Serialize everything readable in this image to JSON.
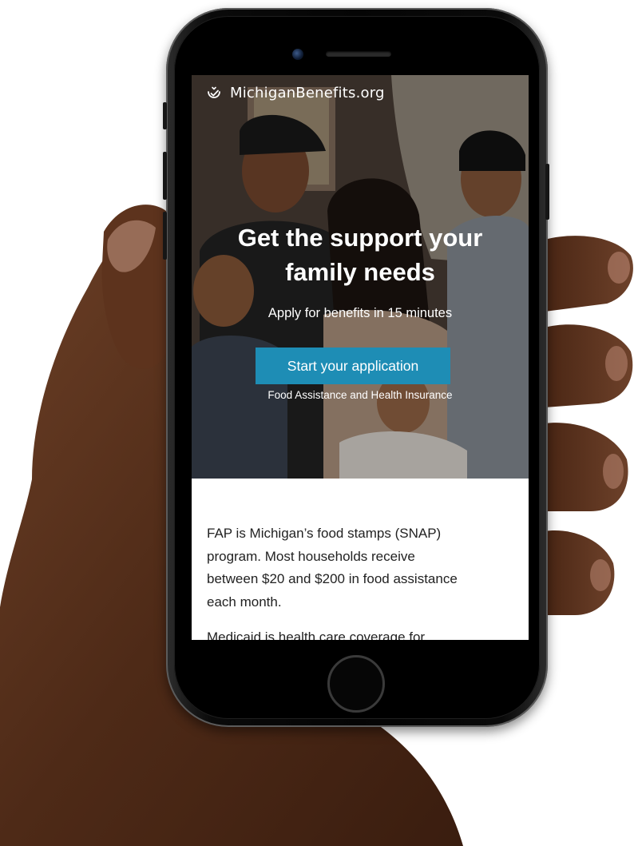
{
  "site": {
    "brand_name": "MichiganBenefits.org",
    "brand_icon": "checkmark-badge-icon"
  },
  "hero": {
    "headline_line1": "Get the support your",
    "headline_line2": "family needs",
    "subheadline": "Apply for benefits in 15 minutes",
    "cta_label": "Start your application",
    "cta_note": "Food Assistance and Health Insurance"
  },
  "content": {
    "paragraph_1_lines": [
      "FAP is Michigan’s food stamps (SNAP)",
      "program. Most households receive",
      "between $20 and $200 in food assistance",
      "each month."
    ],
    "paragraph_2": "Medicaid is health care coverage for"
  },
  "colors": {
    "cta_background": "#1e8db5",
    "hero_text": "#ffffff",
    "body_text": "#222222"
  }
}
